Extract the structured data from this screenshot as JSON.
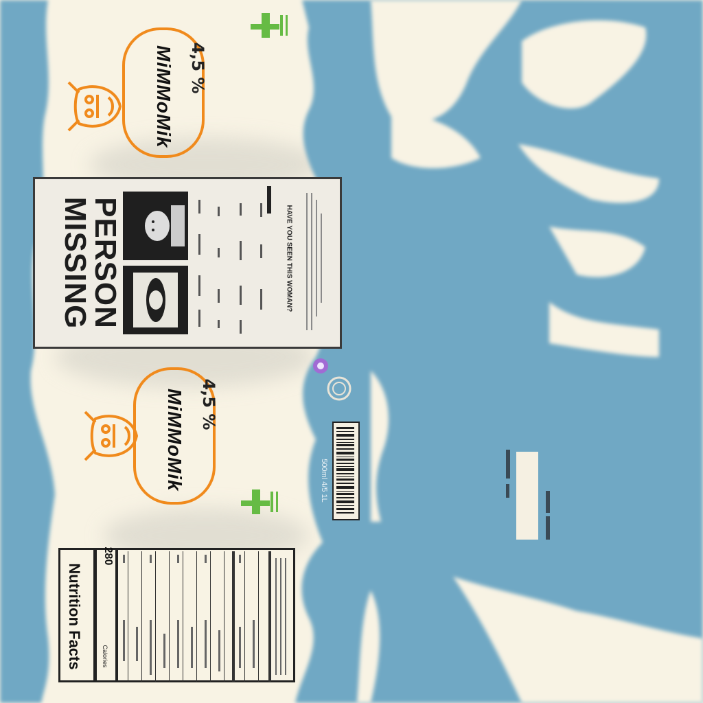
{
  "brand": {
    "name": "MiMMoMik",
    "fat_percent": "4,5 %",
    "accent_color": "#f08a1c",
    "icon": "cow-head-icon",
    "recycle_icon": "green-arrow-icon"
  },
  "missing_poster": {
    "title_line1": "MISSING",
    "title_line2": "PERSON",
    "caption": "HAVE YOU SEEN THIS WOMAN?"
  },
  "nutrition": {
    "title": "Nutrition Facts",
    "calories_label": "Calories",
    "calories_value": "280"
  },
  "package": {
    "volume": "500ml 4/5 1L",
    "background_color": "#f8f3e4",
    "splash_color": "#6fa8c4"
  }
}
